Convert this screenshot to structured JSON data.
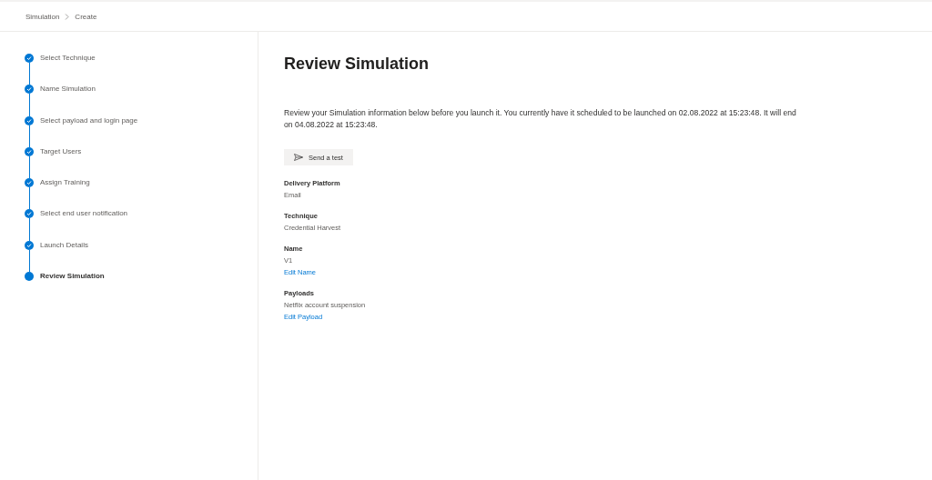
{
  "breadcrumb": [
    "Simulation",
    "Create"
  ],
  "steps": [
    {
      "label": "Select Technique",
      "completed": true,
      "selected": false
    },
    {
      "label": "Name Simulation",
      "completed": true,
      "selected": false
    },
    {
      "label": "Select payload and login page",
      "completed": true,
      "selected": false
    },
    {
      "label": "Target Users",
      "completed": true,
      "selected": false
    },
    {
      "label": "Assign Training",
      "completed": true,
      "selected": false
    },
    {
      "label": "Select end user notification",
      "completed": true,
      "selected": false
    },
    {
      "label": "Launch Details",
      "completed": true,
      "selected": false
    },
    {
      "label": "Review Simulation",
      "completed": false,
      "selected": true
    }
  ],
  "title": "Review Simulation",
  "description": "Review your Simulation information below before you launch it. You currently have it scheduled to be launched on 02.08.2022 at 15:23:48. It will end on 04.08.2022 at 15:23:48.",
  "test_button": "Send a test",
  "sections": [
    {
      "label": "Delivery Platform",
      "value": "Email"
    },
    {
      "label": "Technique",
      "value": "Credential Harvest"
    },
    {
      "label": "Name",
      "value": "V1",
      "link": "Edit Name"
    },
    {
      "label": "Payloads",
      "value": "Netflix account suspension",
      "link": "Edit Payload"
    }
  ]
}
